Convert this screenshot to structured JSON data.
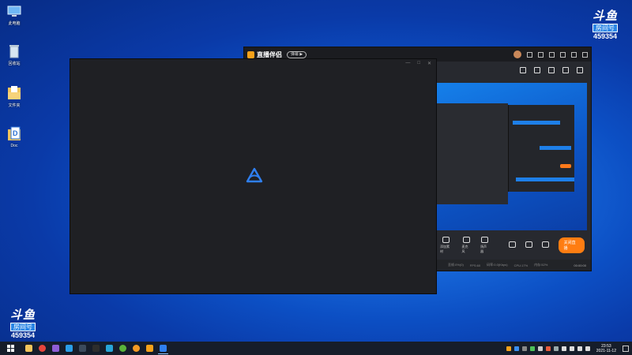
{
  "desktop": {
    "icons": [
      {
        "label": "此电脑",
        "icon": "computer-icon"
      },
      {
        "label": "回收站",
        "icon": "recycle-bin-icon"
      },
      {
        "label": "文件夹",
        "icon": "folder-icon"
      },
      {
        "label": "Doc",
        "icon": "word-icon"
      }
    ]
  },
  "watermark": {
    "brand": "斗鱼",
    "room_label": "房间号",
    "room_number": "459354"
  },
  "app_window": {
    "title": "直播伴侣",
    "version_pill": "弹幕 ▶",
    "controls": [
      {
        "label": "添加素材"
      },
      {
        "label": "麦克风"
      },
      {
        "label": "扬声器"
      }
    ],
    "stop_button": "关闭直播",
    "status": [
      "丢帧:0%(0)",
      "FPS:60",
      "码率:0.0(Kbps)",
      "CPU:17%",
      "内存:52%"
    ],
    "stream_time": "00:00:00"
  },
  "taskbar": {
    "clock_time": "23:53",
    "clock_date": "2021-11-12",
    "colors": {
      "bg": "#161d2a",
      "accent": "#ff7d12"
    }
  }
}
